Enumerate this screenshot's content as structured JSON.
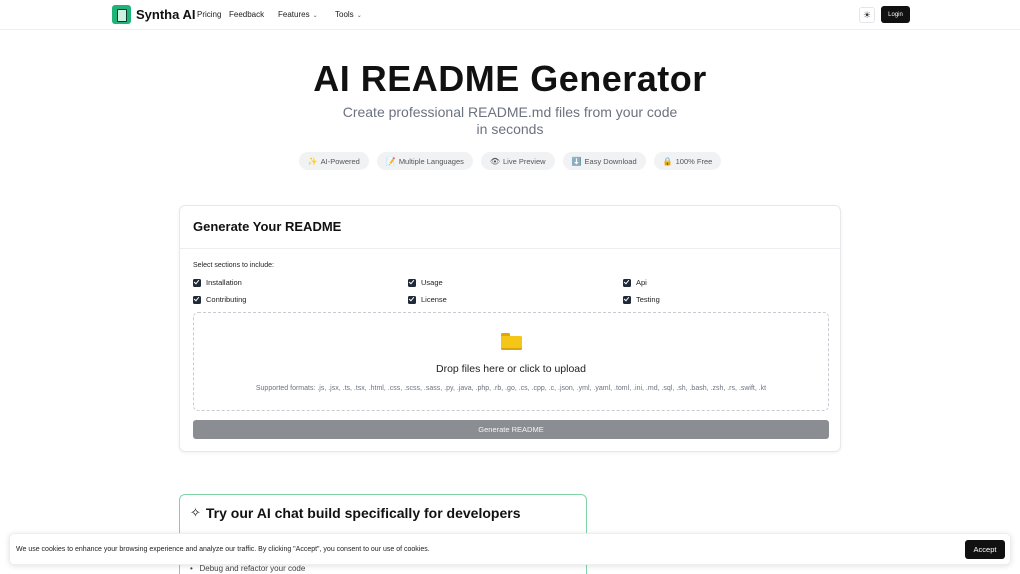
{
  "brand": {
    "name": "Syntha AI",
    "logo_icon": "document-logo-icon"
  },
  "nav": {
    "links": [
      "Pricing",
      "Feedback"
    ],
    "dropdowns": [
      "Features",
      "Tools"
    ],
    "theme_icon": "sun-icon",
    "login_label": "Login"
  },
  "hero": {
    "title": "AI README Generator",
    "subtitle": "Create professional README.md files from your code in seconds",
    "pills": [
      {
        "emoji": "✨",
        "label": "AI-Powered"
      },
      {
        "emoji": "📝",
        "label": "Multiple Languages"
      },
      {
        "emoji": "👁",
        "label": "Live Preview"
      },
      {
        "emoji": "⬇️",
        "label": "Easy Download"
      },
      {
        "emoji": "🔒",
        "label": "100% Free"
      }
    ]
  },
  "generator": {
    "title": "Generate Your README",
    "sections_label": "Select sections to include:",
    "sections": [
      {
        "label": "Installation",
        "checked": true
      },
      {
        "label": "Usage",
        "checked": true
      },
      {
        "label": "Api",
        "checked": true
      },
      {
        "label": "Contributing",
        "checked": true
      },
      {
        "label": "License",
        "checked": true
      },
      {
        "label": "Testing",
        "checked": true
      }
    ],
    "dropzone": {
      "icon": "folder-icon",
      "text": "Drop files here or click to upload",
      "formats": "Supported formats: .js, .jsx, .ts, .tsx, .html, .css, .scss, .sass, .py, .java, .php, .rb, .go, .cs, .cpp, .c, .json, .yml, .yaml, .toml, .ini, .md, .sql, .sh, .bash, .zsh, .rs, .swift, .kt"
    },
    "button_label": "Generate README"
  },
  "chat_promo": {
    "title": "Try our AI chat build specifically for developers",
    "icon": "sparkles-icon",
    "visible_bullet": "Debug and refactor your code"
  },
  "cookie": {
    "text": "We use cookies to enhance your browsing experience and analyze our traffic. By clicking \"Accept\", you consent to our use of cookies.",
    "accept_label": "Accept"
  },
  "colors": {
    "accent": "#1fb37a",
    "button_dark": "#111111",
    "button_disabled": "#8a8d91",
    "promo_border": "#7fd3a7"
  }
}
